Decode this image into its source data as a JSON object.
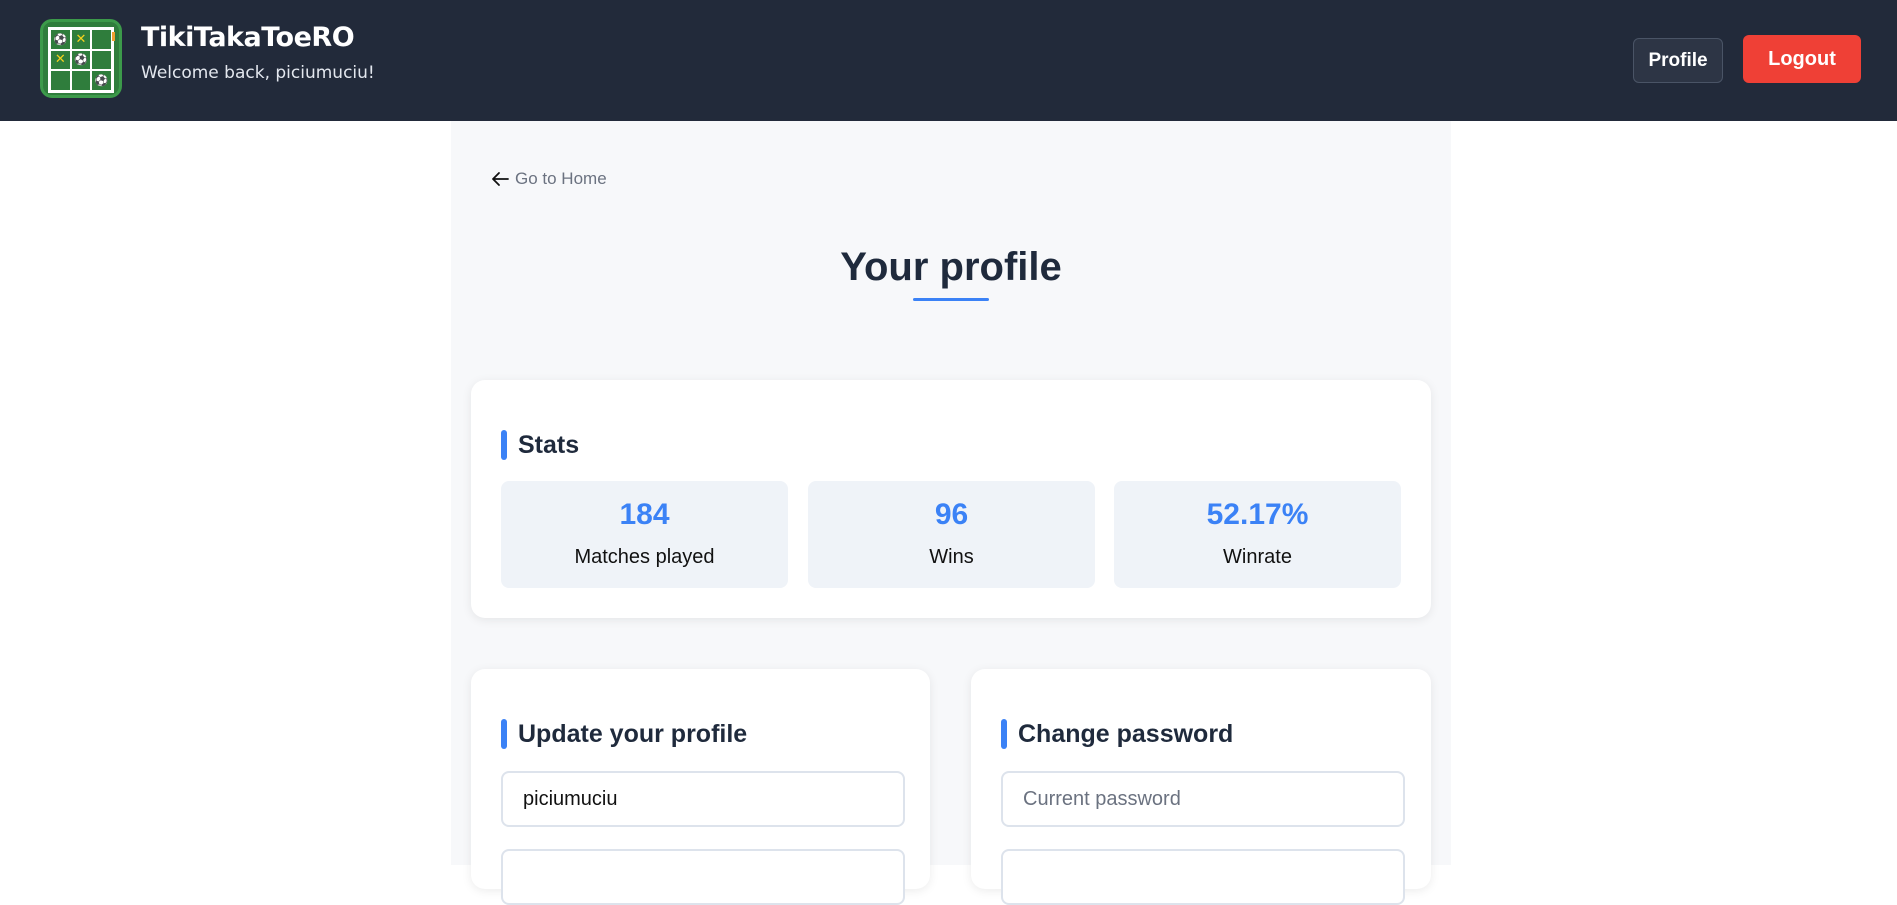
{
  "header": {
    "title": "TikiTakaToeRO",
    "subtitle": "Welcome back, piciumuciu!",
    "profile_label": "Profile",
    "logout_label": "Logout",
    "logo": {
      "cells": [
        "⚽",
        "✕",
        "",
        "✕",
        "⚽",
        "",
        "",
        "",
        "⚽"
      ]
    }
  },
  "main": {
    "back_label": "Go to Home",
    "page_title": "Your profile",
    "stats": {
      "heading": "Stats",
      "items": [
        {
          "value": "184",
          "caption": "Matches played"
        },
        {
          "value": "96",
          "caption": "Wins"
        },
        {
          "value": "52.17%",
          "caption": "Winrate"
        }
      ]
    },
    "update_profile": {
      "heading": "Update your profile",
      "username_value": "piciumuciu"
    },
    "change_password": {
      "heading": "Change password",
      "current_placeholder": "Current password"
    }
  },
  "colors": {
    "header_bg": "#222a3a",
    "accent": "#3b82f6",
    "logout": "#ef4036",
    "page_bg": "#f7f8fa"
  }
}
